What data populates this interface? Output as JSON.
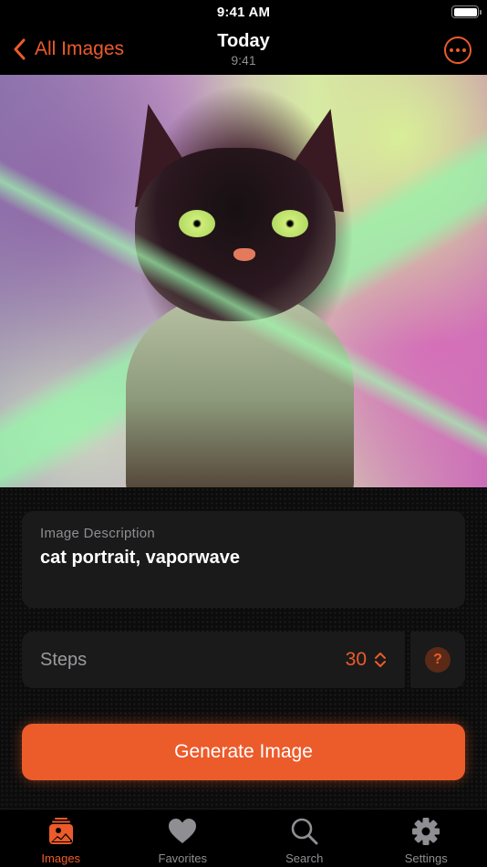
{
  "status_bar": {
    "time": "9:41 AM",
    "battery_icon": "battery-full-icon"
  },
  "nav": {
    "back_label": "All Images",
    "back_icon": "chevron-left-icon",
    "title": "Today",
    "subtitle": "9:41",
    "more_icon": "ellipsis-circle-icon"
  },
  "image": {
    "description": "Generated image: cat portrait in vaporwave style"
  },
  "form": {
    "description_label": "Image Description",
    "description_value": "cat portrait, vaporwave",
    "steps_label": "Steps",
    "steps_value": "30",
    "steps_icon": "chevron-up-down-icon",
    "help_label": "?",
    "generate_label": "Generate Image"
  },
  "tabs": [
    {
      "label": "Images",
      "icon": "photo-stack-icon",
      "active": true
    },
    {
      "label": "Favorites",
      "icon": "heart-icon",
      "active": false
    },
    {
      "label": "Search",
      "icon": "magnifying-glass-icon",
      "active": false
    },
    {
      "label": "Settings",
      "icon": "gear-icon",
      "active": false
    }
  ],
  "colors": {
    "accent": "#ec5b2a",
    "background": "#000000",
    "card": "#1a1a1a",
    "secondary_text": "#8e8e93",
    "inactive_tab": "#8e8e93"
  }
}
